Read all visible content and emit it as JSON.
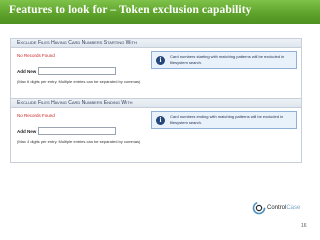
{
  "slide": {
    "title": "Features to look for – Token exclusion capability",
    "page_number": "16"
  },
  "panels": [
    {
      "header": "Exclude Files Having Card Numbers Starting With",
      "no_records": "No Records Found",
      "add_label": "Add New",
      "add_value": "",
      "hint": "(Max 6 digits per entry. Multiple entries can be separated by commas)",
      "info": "Card numbers starting with matching patterns will be excluded in filesystem search."
    },
    {
      "header": "Exclude Files Having Card Numbers Ending With",
      "no_records": "No Records Found",
      "add_label": "Add New",
      "add_value": "",
      "hint": "(Max 4 digits per entry. Multiple entries can be separated by commas)",
      "info": "Card numbers ending with matching patterns will be excluded in filesystem search."
    }
  ],
  "logo": {
    "part1": "Control",
    "part2": "Case",
    "icon": "controlcase-logo-icon"
  },
  "colors": {
    "title_bar": "#5ea32c",
    "error_text": "#cc2222",
    "info_bg": "#e9f1fb",
    "info_icon": "#24477d"
  }
}
